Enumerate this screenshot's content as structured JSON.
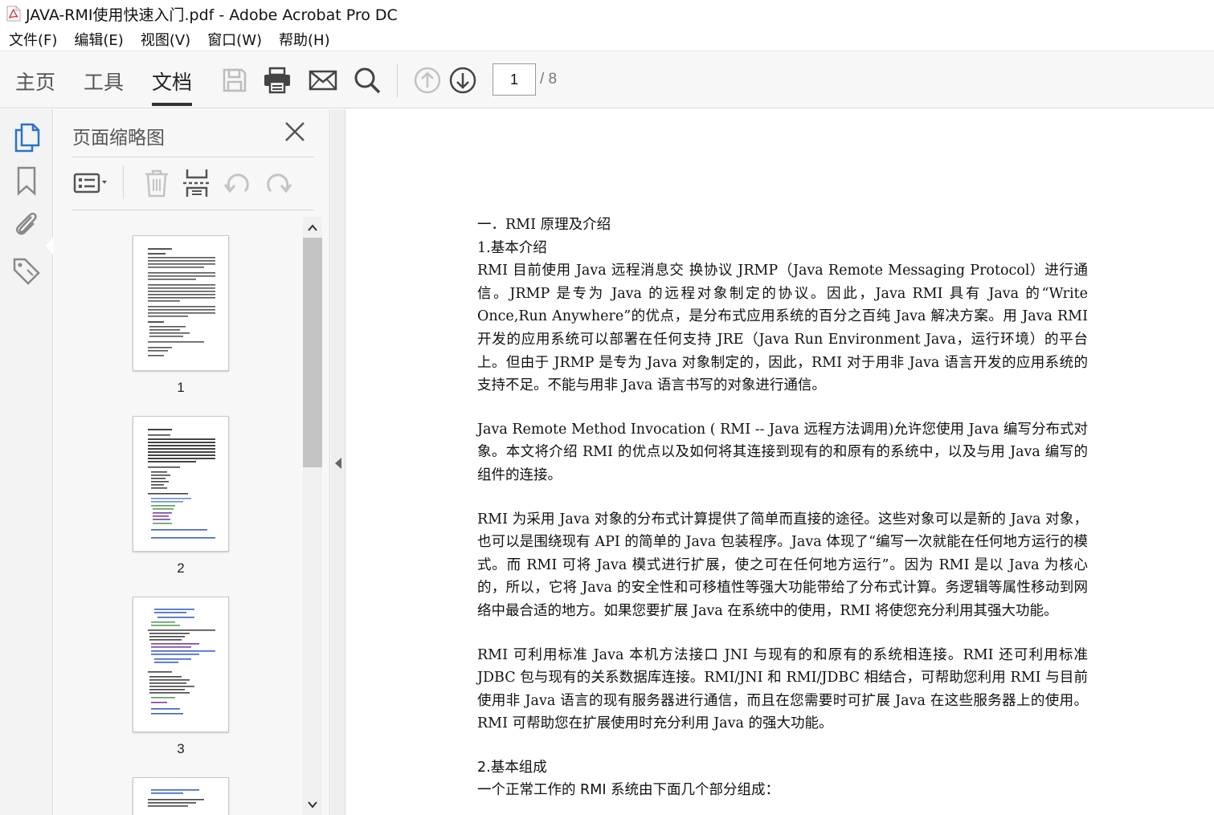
{
  "window": {
    "title": "JAVA-RMI使用快速入门.pdf - Adobe Acrobat Pro DC"
  },
  "menu": [
    {
      "label": "文件(F)"
    },
    {
      "label": "编辑(E)"
    },
    {
      "label": "视图(V)"
    },
    {
      "label": "窗口(W)"
    },
    {
      "label": "帮助(H)"
    }
  ],
  "toolbar": {
    "tabs": [
      {
        "label": "主页"
      },
      {
        "label": "工具"
      },
      {
        "label": "文档"
      }
    ],
    "active_tab": "文档",
    "current_page": "1",
    "total_pages": "/ 8",
    "icons": [
      "save-icon",
      "print-icon",
      "email-icon",
      "search-icon",
      "page-up-icon",
      "page-down-icon"
    ]
  },
  "left_rail": {
    "icons": [
      "page-thumbnails-icon",
      "bookmark-icon",
      "attachment-icon",
      "tag-icon"
    ]
  },
  "thumbnail_panel": {
    "title": "页面缩略图",
    "tools": [
      "thumbnail-options-icon",
      "delete-page-icon",
      "extract-page-icon",
      "rotate-left-icon",
      "rotate-right-icon"
    ],
    "pages": [
      {
        "number": "1"
      },
      {
        "number": "2"
      },
      {
        "number": "3"
      }
    ]
  },
  "document": {
    "lines": [
      {
        "text": "一．RMI 原理及介绍",
        "kind": "heading"
      },
      {
        "text": "1.基本介绍",
        "kind": "heading"
      },
      {
        "text": "RMI 目前使用 Java 远程消息交  换协议 JRMP（Java Remote Messaging Protocol）进行通信。JRMP 是专为 Java 的远程对象制定的协议。因此，Java RMI 具有 Java 的“Write Once,Run Anywhere”的优点，是分布式应用系统的百分之百纯 Java 解决方案。用 Java RMI 开发的应用系统可以部署在任何支持 JRE（Java Run Environment Java，运行环境）的平台上。但由于 JRMP 是专为 Java 对象制定的，因此，RMI 对于用非 Java 语言开发的应用系统的支持不足。不能与用非 Java 语言书写的对象进行通信。",
        "kind": "para"
      },
      {
        "text": "Java Remote Method Invocation ( RMI -- Java 远程方法调用)允许您使用 Java 编写分布式对象。本文将介绍 RMI 的优点以及如何将其连接到现有的和原有的系统中，以及与用 Java  编写的组件的连接。",
        "kind": "para"
      },
      {
        "text": "RMI 为采用 Java 对象的分布式计算提供了简单而直接的途径。这些对象可以是新的 Java 对象，也可以是围绕现有 API 的简单的 Java 包装程序。Java 体现了“编写一次就能在任何地方运行的模式。而 RMI 可将 Java 模式进行扩展，使之可在任何地方运行”。因为 RMI 是以 Java 为核心的，所以，它将 Java 的安全性和可移植性等强大功能带给了分布式计算。务逻辑等属性移动到网络中最合适的地方。如果您要扩展 Java 在系统中的使用，RMI 将使您充分利用其强大功能。",
        "kind": "para"
      },
      {
        "text": "RMI 可利用标准 Java 本机方法接口 JNI 与现有的和原有的系统相连接。RMI 还可利用标准 JDBC 包与现有的关系数据库连接。RMI/JNI 和 RMI/JDBC 相结合，可帮助您利用 RMI 与目前使用非 Java 语言的现有服务器进行通信，而且在您需要时可扩展 Java 在这些服务器上的使用。RMI 可帮助您在扩展使用时充分利用 Java 的强大功能。",
        "kind": "para"
      },
      {
        "text": "2.基本组成",
        "kind": "heading"
      },
      {
        "text": "一个正常工作的 RMI 系统由下面几个部分组成：",
        "kind": "para"
      }
    ]
  }
}
